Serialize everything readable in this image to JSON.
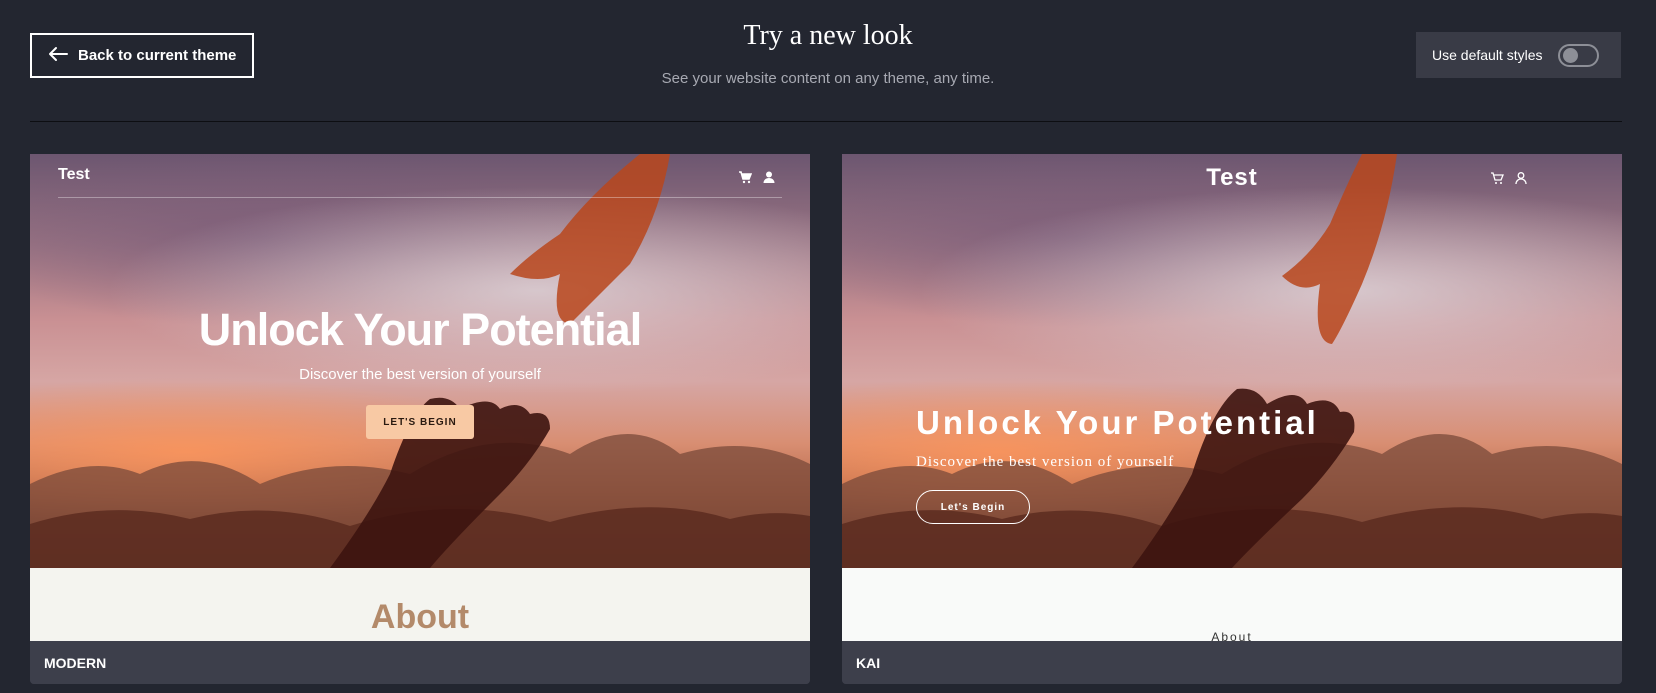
{
  "header": {
    "back_label": "Back to current theme",
    "title": "Try a new look",
    "subtitle": "See your website content on any theme, any time.",
    "toggle_label": "Use default styles",
    "toggle_on": false
  },
  "themes": [
    {
      "name": "MODERN",
      "preview": {
        "brand": "Test",
        "icons": [
          "cart-icon",
          "user-icon"
        ],
        "hero_title": "Unlock Your Potential",
        "hero_subtitle": "Discover the best version of yourself",
        "cta": "LET'S BEGIN",
        "section_title": "About"
      }
    },
    {
      "name": "KAI",
      "preview": {
        "brand": "Test",
        "icons": [
          "cart-icon",
          "user-icon"
        ],
        "hero_title": "Unlock Your Potential",
        "hero_subtitle": "Discover the best version of yourself",
        "cta": "Let's Begin",
        "section_title": "About"
      }
    }
  ],
  "colors": {
    "background": "#232630",
    "card_label_bg": "#3d3f4b",
    "modern_cta": "#f8c9a4",
    "modern_about_title": "#b38a6a"
  }
}
